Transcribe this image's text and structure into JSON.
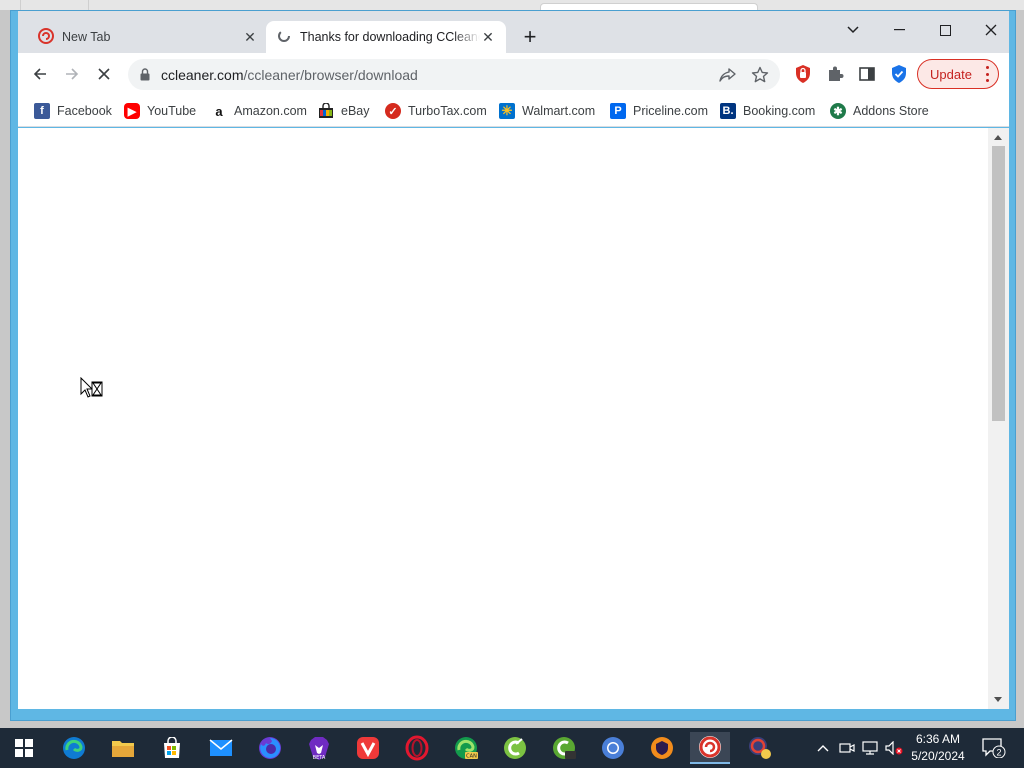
{
  "browser": {
    "tabs": [
      {
        "title": "New Tab",
        "active": false
      },
      {
        "title": "Thanks for downloading CCleaner",
        "active": true
      }
    ],
    "address_bar": {
      "domain": "ccleaner.com",
      "path": "/ccleaner/browser/download"
    },
    "update_button_label": "Update",
    "bookmarks": [
      {
        "label": "Facebook",
        "icon": "facebook-icon"
      },
      {
        "label": "YouTube",
        "icon": "youtube-icon"
      },
      {
        "label": "Amazon.com",
        "icon": "amazon-icon"
      },
      {
        "label": "eBay",
        "icon": "ebay-icon"
      },
      {
        "label": "TurboTax.com",
        "icon": "turbotax-icon"
      },
      {
        "label": "Walmart.com",
        "icon": "walmart-icon"
      },
      {
        "label": "Priceline.com",
        "icon": "priceline-icon"
      },
      {
        "label": "Booking.com",
        "icon": "booking-icon"
      },
      {
        "label": "Addons Store",
        "icon": "addons-store-icon"
      }
    ],
    "page_state": "loading"
  },
  "taskbar": {
    "apps": [
      "start-icon",
      "edge-icon",
      "file-explorer-icon",
      "store-icon",
      "mail-icon",
      "firefox-icon",
      "brave-beta-icon",
      "vivaldi-icon",
      "opera-icon",
      "edge-canary-icon",
      "ccleaner-icon",
      "ccleaner-green-icon",
      "chromium-icon",
      "avast-browser-icon",
      "ccleaner-browser-icon",
      "ccleaner-browser-alt-icon"
    ],
    "clock": {
      "time": "6:36 AM",
      "date": "5/20/2024"
    },
    "notification_count": "2"
  },
  "colors": {
    "window_accent": "#5fb7e4",
    "taskbar": "#1e2a38",
    "update_red": "#c5221f"
  }
}
